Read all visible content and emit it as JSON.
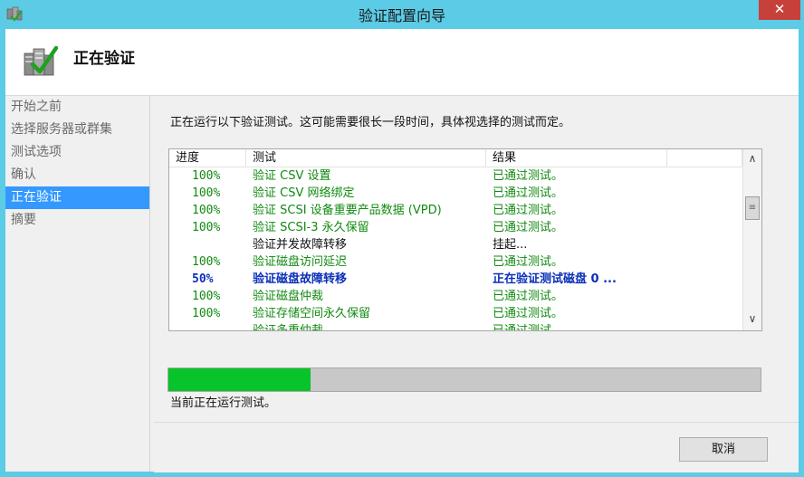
{
  "window": {
    "title": "验证配置向导",
    "close_label": "✕",
    "icon": "cluster-validate-icon"
  },
  "header": {
    "title": "正在验证",
    "icon": "cluster-validate-check-icon"
  },
  "nav": {
    "items": [
      {
        "label": "开始之前"
      },
      {
        "label": "选择服务器或群集"
      },
      {
        "label": "测试选项"
      },
      {
        "label": "确认"
      },
      {
        "label": "正在验证"
      },
      {
        "label": "摘要"
      }
    ]
  },
  "main": {
    "description": "正在运行以下验证测试。这可能需要很长一段时间，具体视选择的测试而定。",
    "columns": [
      "进度",
      "测试",
      "结果"
    ],
    "rows": [
      {
        "progress": "100%",
        "test": "验证 CSV 设置",
        "result": "已通过测试。",
        "state": "pass"
      },
      {
        "progress": "100%",
        "test": "验证 CSV 网络绑定",
        "result": "已通过测试。",
        "state": "pass"
      },
      {
        "progress": "100%",
        "test": "验证 SCSI 设备重要产品数据 (VPD)",
        "result": "已通过测试。",
        "state": "pass"
      },
      {
        "progress": "100%",
        "test": "验证 SCSI-3 永久保留",
        "result": "已通过测试。",
        "state": "pass"
      },
      {
        "progress": "",
        "test": "验证并发故障转移",
        "result": "挂起...",
        "state": "pending"
      },
      {
        "progress": "100%",
        "test": "验证磁盘访问延迟",
        "result": "已通过测试。",
        "state": "pass"
      },
      {
        "progress": "50%",
        "test": "验证磁盘故障转移",
        "result": "正在验证测试磁盘 0 ...",
        "state": "running"
      },
      {
        "progress": "100%",
        "test": "验证磁盘仲裁",
        "result": "已通过测试。",
        "state": "pass"
      },
      {
        "progress": "100%",
        "test": "验证存储空间永久保留",
        "result": "已通过测试。",
        "state": "pass"
      },
      {
        "progress": "",
        "test": "验证多重仲裁",
        "result": "已通过测试。",
        "state": "pass"
      }
    ],
    "overall_progress": 0.24,
    "status_text": "当前正在运行测试。"
  },
  "footer": {
    "cancel_label": "取消"
  },
  "colors": {
    "accent": "#3399ff",
    "progress": "#06c42a",
    "pass": "#118a11",
    "running": "#0a2fb8",
    "titlebar": "#5bcbe6",
    "close": "#c7413a"
  }
}
